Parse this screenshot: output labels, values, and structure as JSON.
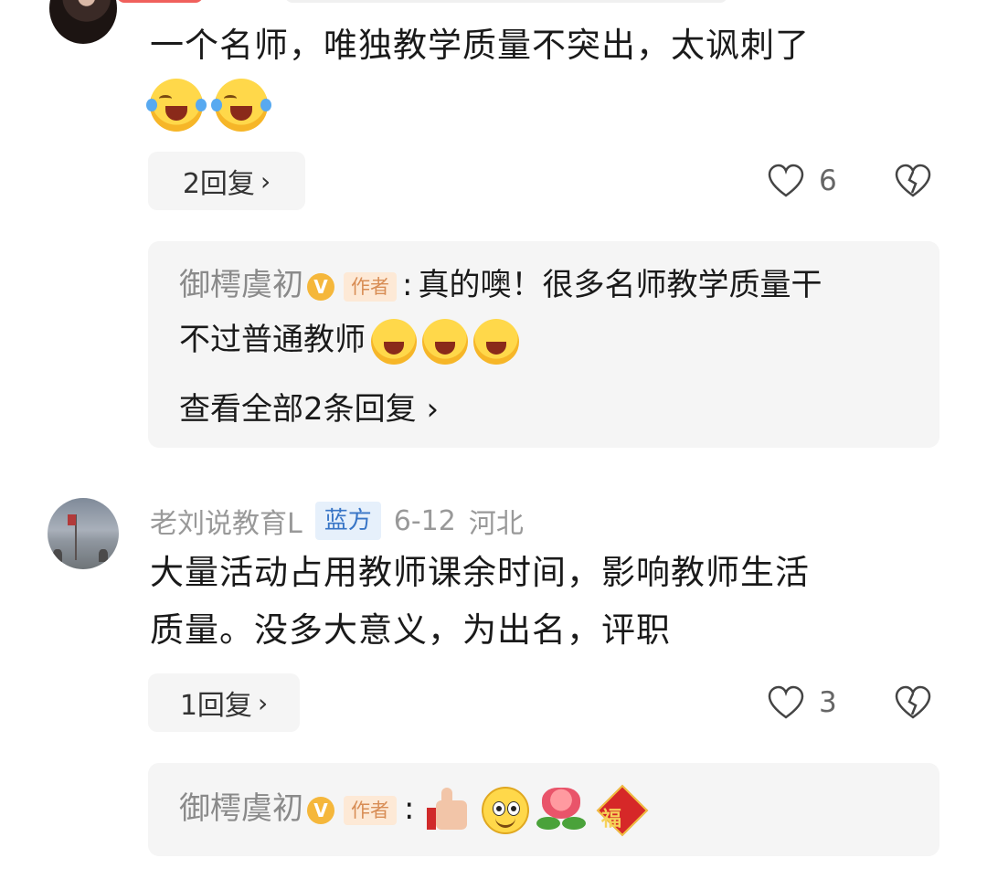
{
  "comment1": {
    "text": "一个名师，唯独教学质量不突出，太讽刺了",
    "emojis": [
      "face-with-tears-of-joy",
      "face-with-tears-of-joy"
    ],
    "reply_button": "2回复",
    "likes": "6"
  },
  "sub_reply1": {
    "author": "御樗虞初",
    "badge": "V",
    "tag": "作者",
    "colon": ":",
    "line1": "真的噢！很多名师教学质量干",
    "line2": "不过普通教师",
    "emojis": [
      "face-with-tears-of-joy",
      "face-with-tears-of-joy",
      "face-with-tears-of-joy"
    ],
    "view_all": "查看全部2条回复"
  },
  "comment2": {
    "author": "老刘说教育L",
    "tag": "蓝方",
    "date": "6-12",
    "location": "河北",
    "line1": "大量活动占用教师课余时间，影响教师生活",
    "line2": "质量。没多大意义，为出名，评职",
    "reply_button": "1回复",
    "likes": "3"
  },
  "sub_reply2": {
    "author": "御樗虞初",
    "badge": "V",
    "tag": "作者",
    "colon": ":",
    "emojis": [
      "thumbs-up",
      "smiling-face",
      "rose",
      "fu-blessing"
    ],
    "fu_char": "福"
  },
  "chevron": "›"
}
